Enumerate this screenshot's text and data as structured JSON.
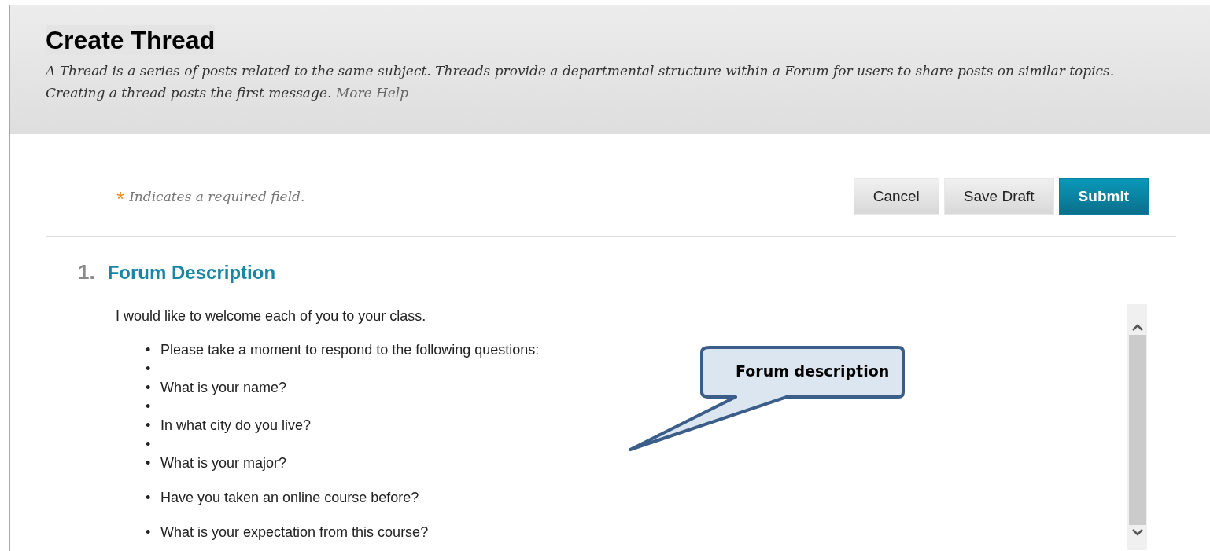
{
  "header": {
    "title": "Create Thread",
    "description": "A Thread is a series of posts related to the same subject. Threads provide a departmental structure within a Forum for users to share posts on similar topics. Creating a thread posts the first message.",
    "help_link": "More Help"
  },
  "required_note": {
    "mark": "*",
    "text": "Indicates a required field."
  },
  "buttons": [
    {
      "label": "Cancel",
      "kind": "secondary"
    },
    {
      "label": "Save Draft",
      "kind": "secondary"
    },
    {
      "label": "Submit",
      "kind": "primary"
    }
  ],
  "section": {
    "number": "1.",
    "title": "Forum Description",
    "intro": "I would like to welcome each of you to your class.",
    "items": [
      {
        "bullet": "•",
        "text": "Please take a moment to respond to the following questions:",
        "spaced": false
      },
      {
        "bullet": "•",
        "spaced": false
      },
      {
        "bullet": "•",
        "text": "What is your name?",
        "spaced": false
      },
      {
        "bullet": "•",
        "spaced": false
      },
      {
        "bullet": "•",
        "text": "In what city do you live?",
        "spaced": false
      },
      {
        "bullet": "•",
        "spaced": false
      },
      {
        "bullet": "•",
        "text": "What is your major?",
        "spaced": false
      },
      {
        "bullet": "•",
        "text": "Have you taken an online course before?",
        "spaced": true
      },
      {
        "bullet": "•",
        "text": "What is your expectation from this course?",
        "spaced": true
      }
    ]
  },
  "callout": {
    "text": "Forum description"
  }
}
